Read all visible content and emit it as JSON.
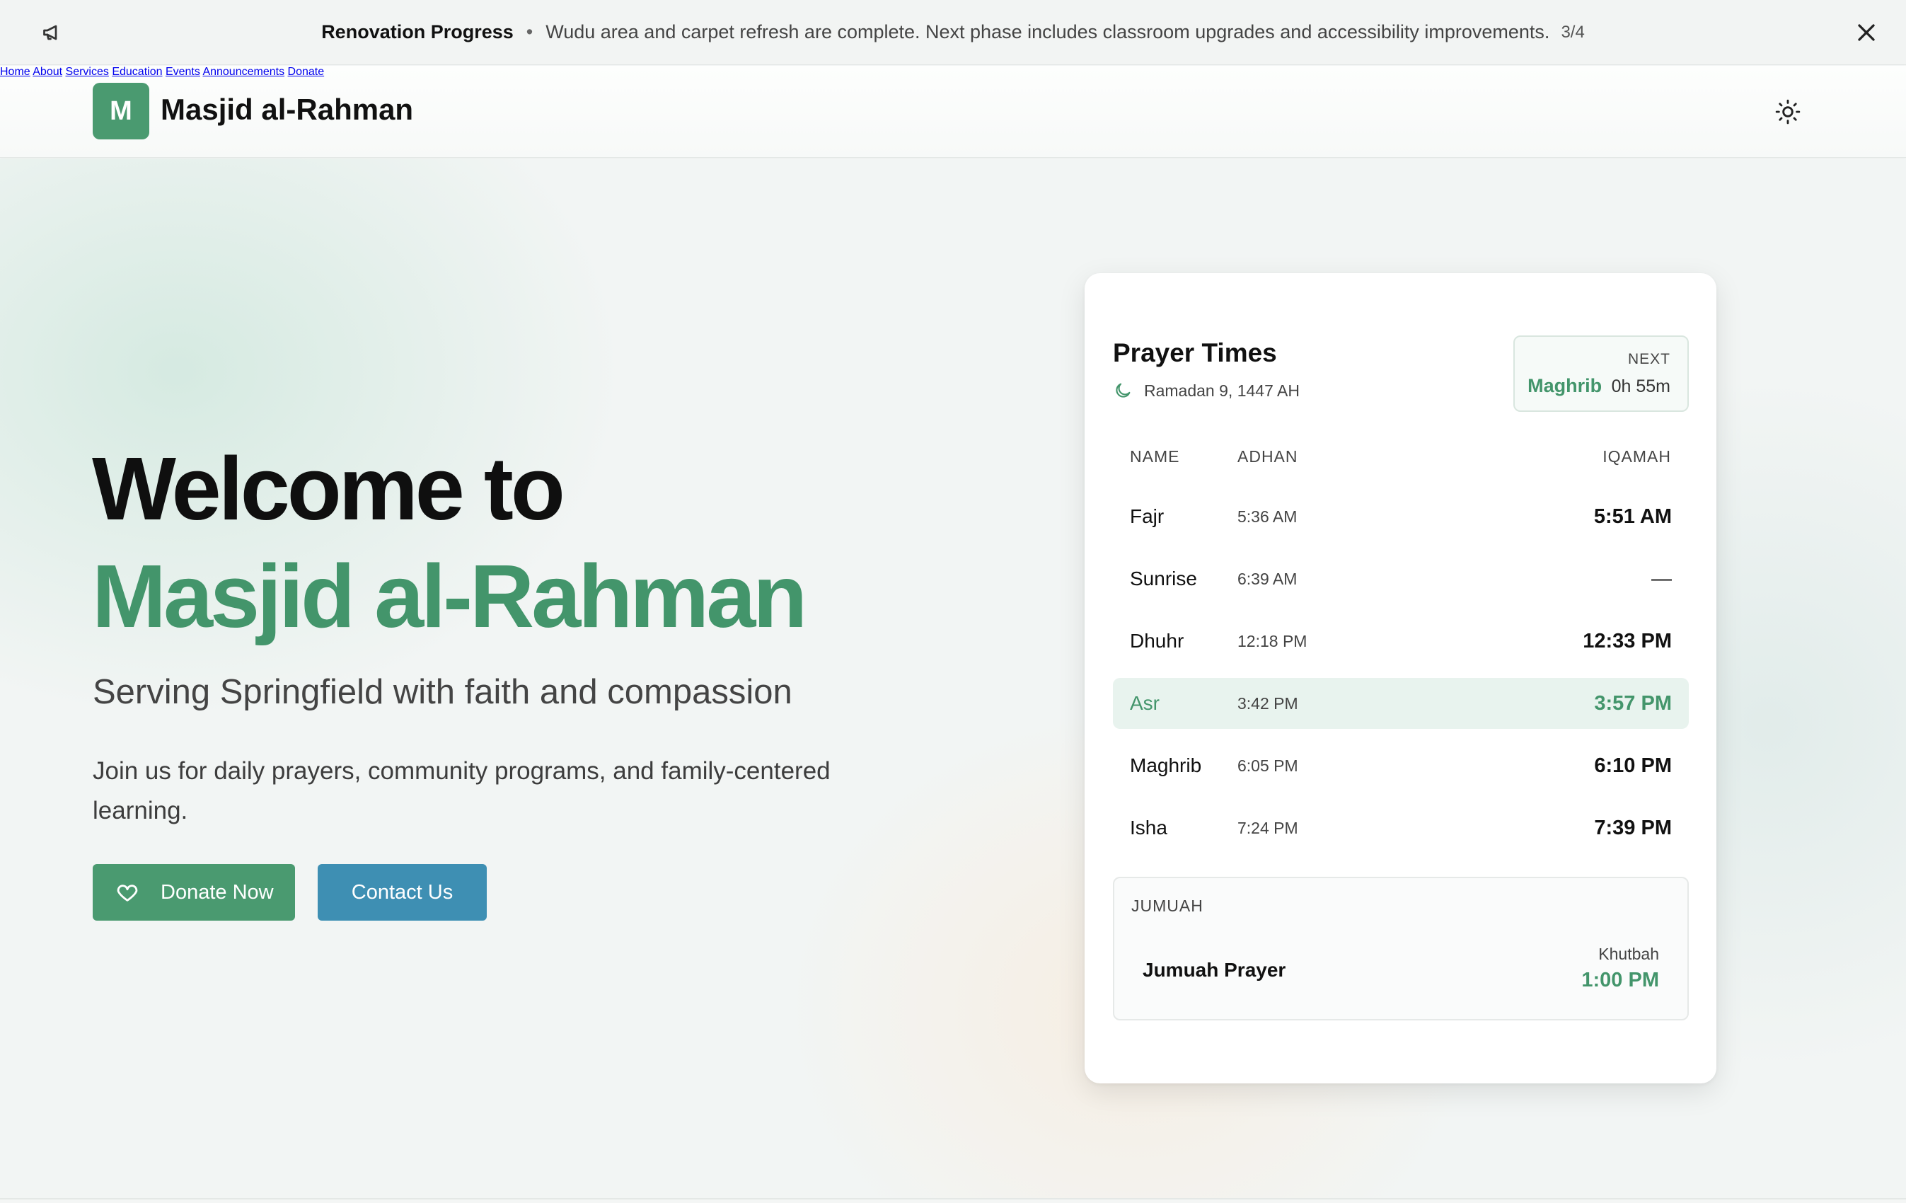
{
  "announcement": {
    "title": "Renovation Progress",
    "separator": "•",
    "message": "Wudu area and carpet refresh are complete. Next phase includes classroom upgrades and accessibility improvements.",
    "counter": "3/4"
  },
  "header": {
    "logo_letter": "M",
    "brand": "Masjid al-Rahman",
    "nav": [
      "Home",
      "About",
      "Services",
      "Education",
      "Events",
      "Announcements",
      "Donate"
    ]
  },
  "hero": {
    "line1": "Welcome to",
    "line2": "Masjid al-Rahman",
    "tagline": "Serving Springfield with faith and compassion",
    "description": "Join us for daily prayers, community programs, and family-centered learning.",
    "donate_label": "Donate Now",
    "contact_label": "Contact Us"
  },
  "prayer_card": {
    "title": "Prayer Times",
    "hijri_date": "Ramadan 9, 1447 AH",
    "next_label": "NEXT",
    "next_prayer": "Maghrib",
    "next_remaining": "0h 55m",
    "columns": [
      "NAME",
      "ADHAN",
      "IQAMAH"
    ],
    "rows": [
      {
        "name": "Fajr",
        "adhan": "5:36 AM",
        "iqamah": "5:51 AM"
      },
      {
        "name": "Sunrise",
        "adhan": "6:39 AM",
        "iqamah": "—"
      },
      {
        "name": "Dhuhr",
        "adhan": "12:18 PM",
        "iqamah": "12:33 PM"
      },
      {
        "name": "Asr",
        "adhan": "3:42 PM",
        "iqamah": "3:57 PM"
      },
      {
        "name": "Maghrib",
        "adhan": "6:05 PM",
        "iqamah": "6:10 PM"
      },
      {
        "name": "Isha",
        "adhan": "7:24 PM",
        "iqamah": "7:39 PM"
      }
    ],
    "active_row": "Asr",
    "jumuah": {
      "label": "JUMUAH",
      "name": "Jumuah Prayer",
      "sub_label": "Khutbah",
      "time": "1:00 PM"
    }
  },
  "colors": {
    "brand_green": "#43956b",
    "contact_blue": "#3e8fb3"
  }
}
